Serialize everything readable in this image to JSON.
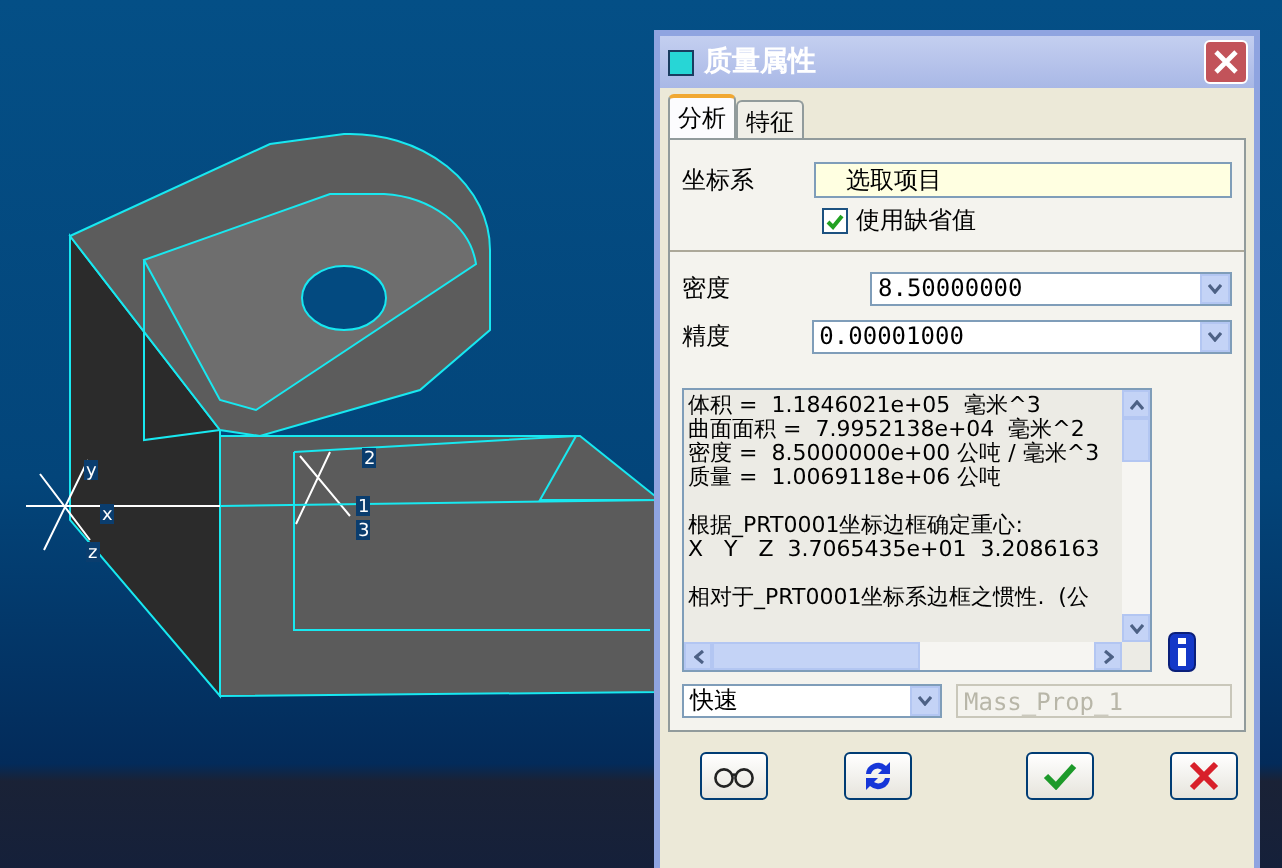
{
  "viewport": {
    "axis_labels": [
      "y",
      "x",
      "z"
    ],
    "csys_labels": [
      "2",
      "1",
      "3"
    ]
  },
  "dialog": {
    "title": "质量属性",
    "tabs": [
      {
        "label": "分析",
        "selected": true
      },
      {
        "label": "特征",
        "selected": false
      }
    ],
    "csys": {
      "label": "坐标系",
      "value": "选取项目",
      "use_default": {
        "label": "使用缺省值",
        "checked": true
      }
    },
    "density": {
      "label": "密度",
      "value": "8.50000000"
    },
    "precision": {
      "label": "精度",
      "value": "0.00001000"
    },
    "results": {
      "paragraphs": [
        [
          "体积 =  1.1846021e+05  毫米^3",
          "曲面面积 =  7.9952138e+04  毫米^2",
          "密度 =  8.5000000e+00 公吨 / 毫米^3",
          "质量 =  1.0069118e+06 公吨"
        ],
        [
          "根据_PRT0001坐标边框确定重心:",
          "X   Y   Z  3.7065435e+01  3.2086163"
        ],
        [
          "相对于_PRT0001坐标系边框之惯性.  (公"
        ]
      ]
    },
    "mode": {
      "value": "快速"
    },
    "name_field": {
      "value": "Mass_Prop_1",
      "disabled": true
    },
    "buttons": [
      {
        "kind": "preview"
      },
      {
        "kind": "recompute"
      },
      {
        "kind": "ok"
      },
      {
        "kind": "cancel"
      }
    ]
  }
}
